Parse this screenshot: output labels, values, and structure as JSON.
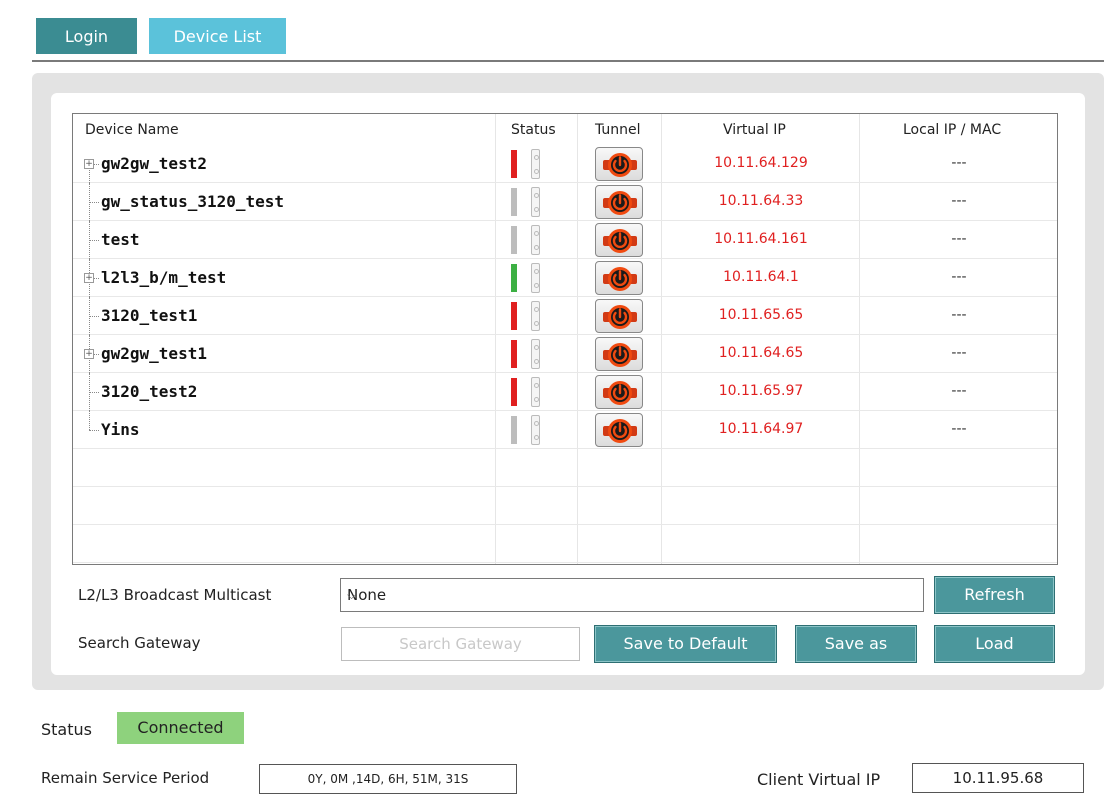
{
  "tabs": {
    "login": "Login",
    "device_list": "Device List"
  },
  "table": {
    "headers": {
      "device_name": "Device Name",
      "status": "Status",
      "tunnel": "Tunnel",
      "virtual_ip": "Virtual IP",
      "local_ip_mac": "Local IP / MAC"
    },
    "rows": [
      {
        "name": "gw2gw_test2",
        "expandable": true,
        "status_color": "#e02020",
        "virtual_ip": "10.11.64.129",
        "local_ip_mac": "---"
      },
      {
        "name": "gw_status_3120_test",
        "expandable": false,
        "status_color": "#bdbdbd",
        "virtual_ip": "10.11.64.33",
        "local_ip_mac": "---"
      },
      {
        "name": "test",
        "expandable": false,
        "status_color": "#bdbdbd",
        "virtual_ip": "10.11.64.161",
        "local_ip_mac": "---"
      },
      {
        "name": "l2l3_b/m_test",
        "expandable": true,
        "status_color": "#3cb043",
        "virtual_ip": "10.11.64.1",
        "local_ip_mac": "---"
      },
      {
        "name": "3120_test1",
        "expandable": false,
        "status_color": "#e02020",
        "virtual_ip": "10.11.65.65",
        "local_ip_mac": "---"
      },
      {
        "name": "gw2gw_test1",
        "expandable": true,
        "status_color": "#e02020",
        "virtual_ip": "10.11.64.65",
        "local_ip_mac": "---"
      },
      {
        "name": "3120_test2",
        "expandable": false,
        "status_color": "#e02020",
        "virtual_ip": "10.11.65.97",
        "local_ip_mac": "---"
      },
      {
        "name": "Yins",
        "expandable": false,
        "status_color": "#bdbdbd",
        "virtual_ip": "10.11.64.97",
        "local_ip_mac": "---"
      }
    ]
  },
  "controls": {
    "broadcast_label": "L2/L3 Broadcast Multicast",
    "broadcast_value": "None",
    "refresh": "Refresh",
    "search_label": "Search Gateway",
    "search_placeholder": "Search Gateway",
    "save_default": "Save to Default",
    "save_as": "Save as",
    "load": "Load"
  },
  "footer": {
    "status_label": "Status",
    "status_value": "Connected",
    "remain_label": "Remain Service Period",
    "remain_value": "0Y, 0M ,14D, 6H, 51M, 31S",
    "client_ip_label": "Client Virtual IP",
    "client_ip_value": "10.11.95.68"
  },
  "colors": {
    "accent": "#4b979c",
    "tab_active": "#5bc2da",
    "connected": "#8ed27d",
    "ip_text": "#e02020"
  }
}
